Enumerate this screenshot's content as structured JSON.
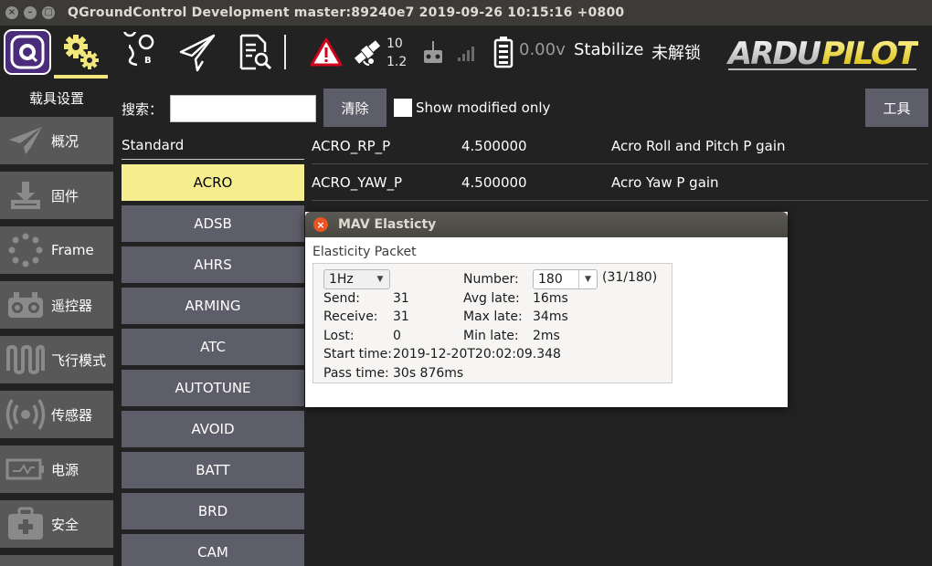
{
  "window": {
    "title": "QGroundControl Development master:89240e7 2019-09-26 10:15:16 +0800",
    "buttons": [
      "×",
      "–",
      "□"
    ]
  },
  "toolbar": {
    "gps_count": "10",
    "gps_hdop": "1.2",
    "battery": "0.00v",
    "flight_mode": "Stabilize",
    "arm_status": "未解锁",
    "logo_text": "ARDUPILOT",
    "active_color": "#f1e77b"
  },
  "sidebar": {
    "title": "载具设置",
    "items": [
      {
        "label": "概况",
        "icon": "paper-plane-icon"
      },
      {
        "label": "固件",
        "icon": "download-icon"
      },
      {
        "label": "Frame",
        "icon": "frame-icon"
      },
      {
        "label": "遥控器",
        "icon": "remote-control-icon"
      },
      {
        "label": "飞行模式",
        "icon": "waveform-icon"
      },
      {
        "label": "传感器",
        "icon": "sensor-icon"
      },
      {
        "label": "电源",
        "icon": "battery-icon"
      },
      {
        "label": "安全",
        "icon": "first-aid-icon"
      }
    ]
  },
  "params": {
    "search_label": "搜索：",
    "search_value": "",
    "clear_label": "清除",
    "show_modified_label": "Show modified only",
    "tools_label": "工具",
    "group_title": "Standard",
    "groups": [
      "ACRO",
      "ADSB",
      "AHRS",
      "ARMING",
      "ATC",
      "AUTOTUNE",
      "AVOID",
      "BATT",
      "BRD",
      "CAM"
    ],
    "selected_group": "ACRO",
    "rows": [
      {
        "name": "ACRO_RP_P",
        "value": "4.500000",
        "desc": "Acro Roll and Pitch P gain"
      },
      {
        "name": "ACRO_YAW_P",
        "value": "4.500000",
        "desc": "Acro Yaw P gain"
      }
    ]
  },
  "dialog": {
    "title": "MAV Elasticty",
    "group_title": "Elasticity Packet",
    "rate": "1Hz",
    "number_label": "Number:",
    "number_value": "180",
    "number_ratio": "(31/180)",
    "send_label": "Send:",
    "send_value": "31",
    "receive_label": "Receive:",
    "receive_value": "31",
    "lost_label": "Lost:",
    "lost_value": "0",
    "avg_label": "Avg late:",
    "avg_value": "16ms",
    "max_label": "Max late:",
    "max_value": "34ms",
    "min_label": "Min late:",
    "min_value": "2ms",
    "start_label": "Start time:",
    "start_value": "2019-12-20T20:02:09.348",
    "pass_label": "Pass time:",
    "pass_value": "30s 876ms"
  }
}
